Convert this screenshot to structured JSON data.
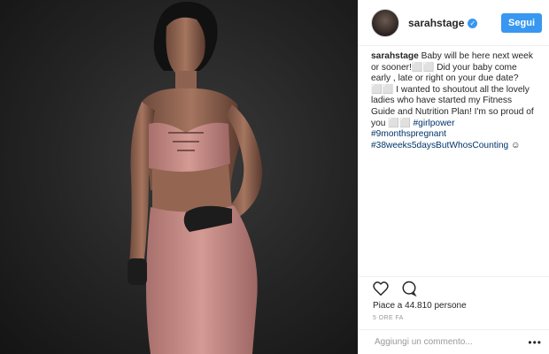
{
  "post": {
    "username": "sarahstage",
    "verified_mark": "✓",
    "follow_label": "Segui",
    "caption_user": "sarahstage",
    "caption_text": "Baby will be here next week or sooner!⬜⬜ Did your baby come early , late or right on your due date? ⬜⬜ I wanted to shoutout all the lovely ladies who have started my Fitness Guide and Nutrition Plan! I'm so proud of you ⬜⬜",
    "hashtags": [
      "#girlpower",
      "#9monthspregnant",
      "#38weeks5daysButWhosCounting"
    ],
    "trailing_emoji": "☺",
    "likes_text": "Piace a 44.810 persone",
    "time_text": "5 ORE FA",
    "comment_placeholder": "Aggiungi un commento...",
    "more_label": "•••"
  },
  "icons": {
    "like": "heart-icon",
    "comment": "comment-icon",
    "verified": "verified-badge-icon",
    "more": "more-options-icon"
  },
  "colors": {
    "accent": "#3897f0",
    "hashtag": "#003569",
    "outfit": "#c98a86",
    "background_photo": "#242424"
  }
}
